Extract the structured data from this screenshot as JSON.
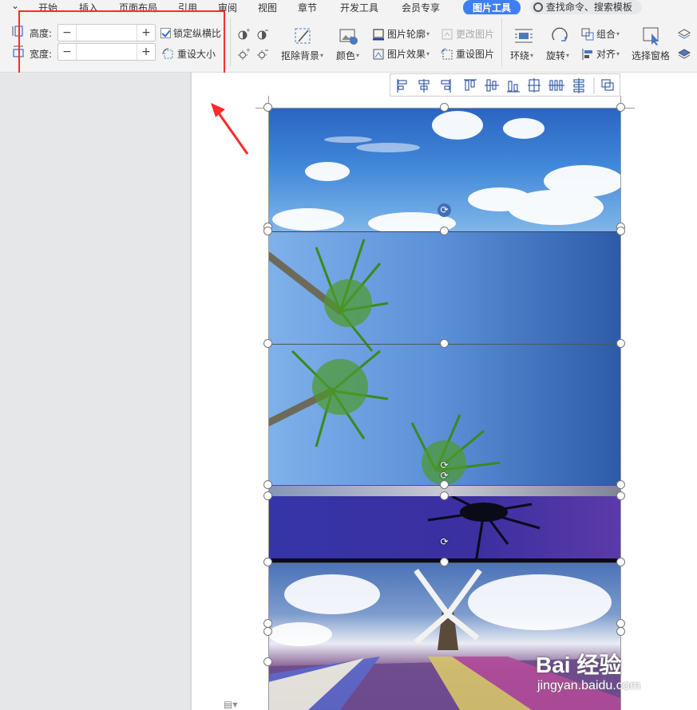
{
  "tabs": [
    {
      "label": "开始"
    },
    {
      "label": "插入"
    },
    {
      "label": "页面布局"
    },
    {
      "label": "引用"
    },
    {
      "label": "审阅"
    },
    {
      "label": "视图"
    },
    {
      "label": "章节"
    },
    {
      "label": "开发工具"
    },
    {
      "label": "会员专享"
    },
    {
      "label": "图片工具",
      "active": true
    }
  ],
  "search": {
    "label": "查找命令、搜索模板",
    "icon": "search-icon"
  },
  "size_group": {
    "height_label": "高度:",
    "height_value": "",
    "width_label": "宽度:",
    "width_value": "",
    "lock_ratio_label": "锁定纵横比",
    "lock_ratio_checked": true,
    "reset_size_label": "重设大小",
    "minus": "−",
    "plus": "+"
  },
  "ribbon": {
    "remove_bg_label": "抠除背景",
    "color_label": "颜色",
    "outline_label": "图片轮廓",
    "effect_label": "图片效果",
    "change_pic_label": "更改图片",
    "reset_pic_label": "重设图片",
    "wrap_label": "环绕",
    "rotate_label": "旋转",
    "group_label": "组合",
    "align_label": "对齐",
    "select_pane_label": "选择窗格"
  },
  "watermark": {
    "logo": "Bai 经验",
    "url": "jingyan.baidu.com"
  },
  "colors": {
    "accent": "#3f7ff3",
    "highlight_box": "#ff2a2a",
    "arrow": "#ff2a2a"
  }
}
